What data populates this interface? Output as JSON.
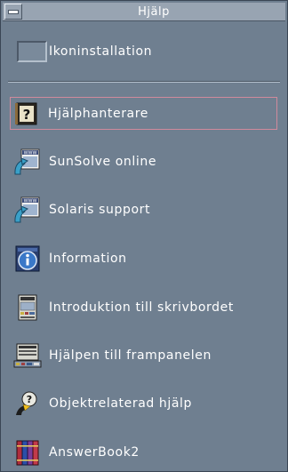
{
  "window": {
    "title": "Hjälp"
  },
  "install": {
    "label": "Ikoninstallation"
  },
  "items": [
    {
      "label": "Hjälphanterare",
      "icon": "help-manager-icon"
    },
    {
      "label": "SunSolve online",
      "icon": "sunsolve-online-icon"
    },
    {
      "label": "Solaris support",
      "icon": "solaris-support-icon"
    },
    {
      "label": "Information",
      "icon": "information-icon"
    },
    {
      "label": "Introduktion till skrivbordet",
      "icon": "desktop-intro-icon"
    },
    {
      "label": "Hjälpen till frampanelen",
      "icon": "front-panel-help-icon"
    },
    {
      "label": "Objektrelaterad hjälp",
      "icon": "on-item-help-icon"
    },
    {
      "label": "AnswerBook2",
      "icon": "answerbook-icon"
    }
  ]
}
